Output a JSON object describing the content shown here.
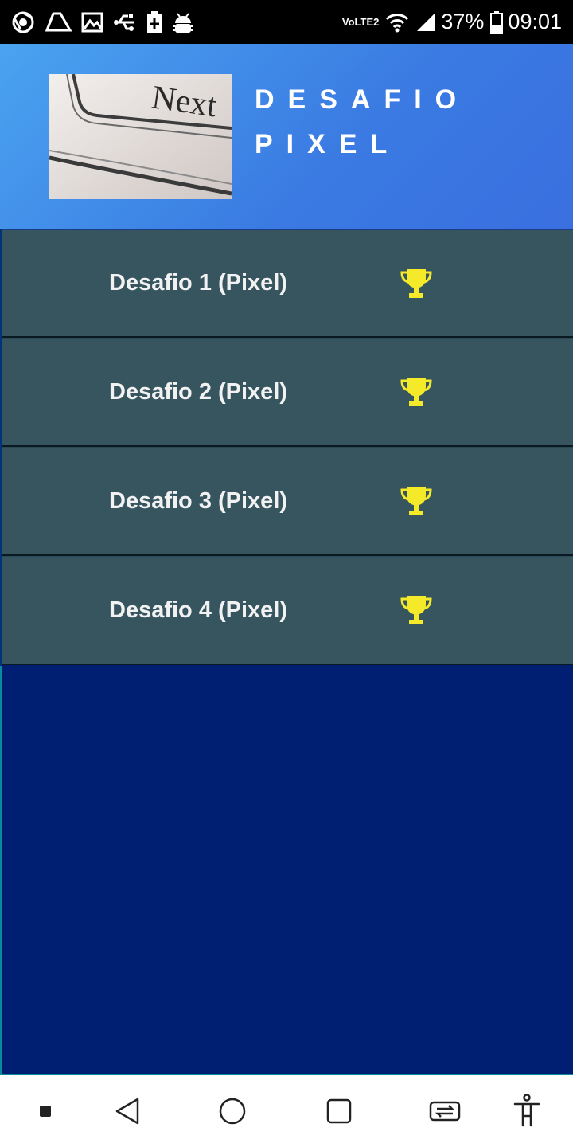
{
  "status_bar": {
    "left_icons": [
      "chrome-icon",
      "drive-icon",
      "image-icon",
      "usb-icon",
      "battery-charging-icon",
      "android-debug-icon"
    ],
    "volte_label_top": "Vo",
    "volte_label_bottom": "LTE2",
    "battery_percent": "37%",
    "time": "09:01"
  },
  "header": {
    "logo_text": "Next",
    "title_line1": "DESAFIO",
    "title_line2": "PIXEL"
  },
  "challenges": [
    {
      "label": "Desafio 1 (Pixel)",
      "icon": "trophy-icon"
    },
    {
      "label": "Desafio 2 (Pixel)",
      "icon": "trophy-icon"
    },
    {
      "label": "Desafio 3 (Pixel)",
      "icon": "trophy-icon"
    },
    {
      "label": "Desafio 4 (Pixel)",
      "icon": "trophy-icon"
    }
  ],
  "nav_bar": {
    "buttons": [
      "small-square-icon",
      "back-icon",
      "home-icon",
      "recents-icon",
      "switch-app-icon",
      "accessibility-icon"
    ]
  },
  "colors": {
    "status_bar": "#000000",
    "header_gradient_start": "#4aa3f0",
    "header_gradient_end": "#3a6fe0",
    "list_item_bg": "#37555f",
    "trophy": "#f5ea2a",
    "body_bg": "#001f73",
    "nav_bar": "#ffffff"
  }
}
